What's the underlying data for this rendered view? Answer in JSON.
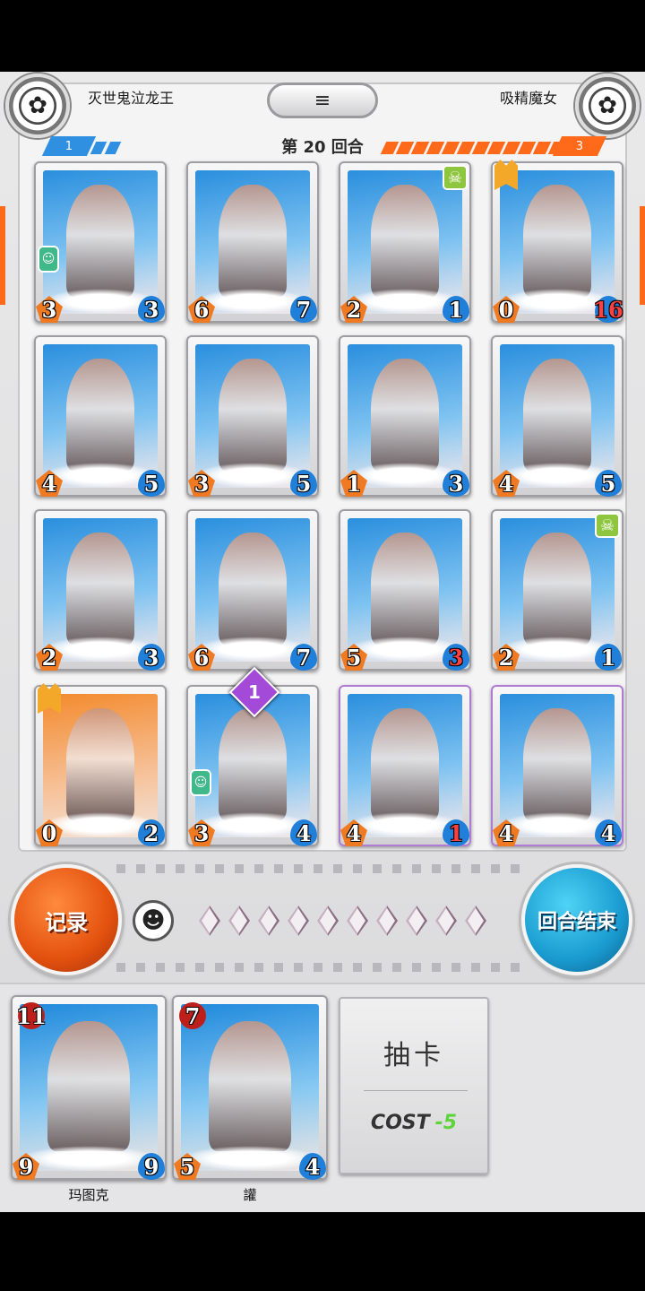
{
  "header": {
    "left_player": "灭世鬼泣龙王",
    "right_player": "吸精魔女",
    "menu_icon": "≡",
    "round_label": "第 20 回合",
    "left_count": "1",
    "right_count": "3"
  },
  "field": [
    {
      "atk": "3",
      "hp": "3",
      "badge": "mask"
    },
    {
      "atk": "6",
      "hp": "7"
    },
    {
      "atk": "2",
      "hp": "1",
      "badge": "skull"
    },
    {
      "atk": "0",
      "hp": "16",
      "hurt": true,
      "badge": "crown"
    },
    {
      "atk": "4",
      "hp": "5"
    },
    {
      "atk": "3",
      "hp": "5"
    },
    {
      "atk": "1",
      "hp": "3"
    },
    {
      "atk": "4",
      "hp": "5"
    },
    {
      "atk": "2",
      "hp": "3"
    },
    {
      "atk": "6",
      "hp": "7"
    },
    {
      "atk": "5",
      "hp": "3",
      "hurt": true
    },
    {
      "atk": "2",
      "hp": "1",
      "badge": "skull"
    },
    {
      "atk": "0",
      "hp": "2",
      "badge": "crown"
    },
    {
      "atk": "3",
      "hp": "4",
      "badge": "mask"
    },
    {
      "atk": "4",
      "hp": "1",
      "hurt": true
    },
    {
      "atk": "4",
      "hp": "4"
    }
  ],
  "diamond_badge": "1",
  "controls": {
    "record_label": "记录",
    "end_turn_label": "回合结束",
    "emote_icon": "☻",
    "crystal_count": 10
  },
  "hand": [
    {
      "name": "玛图克",
      "cost": "11",
      "atk": "9",
      "hp": "9"
    },
    {
      "name": "讙",
      "cost": "7",
      "atk": "5",
      "hp": "4"
    }
  ],
  "draw": {
    "label": "抽卡",
    "cost_label": "COST",
    "cost_value": "-5"
  },
  "colors": {
    "ally_blue": "#2f8fe0",
    "enemy_orange": "#ff6a1a",
    "record_orange": "#e3510f",
    "end_turn_blue": "#1a9bd0"
  }
}
